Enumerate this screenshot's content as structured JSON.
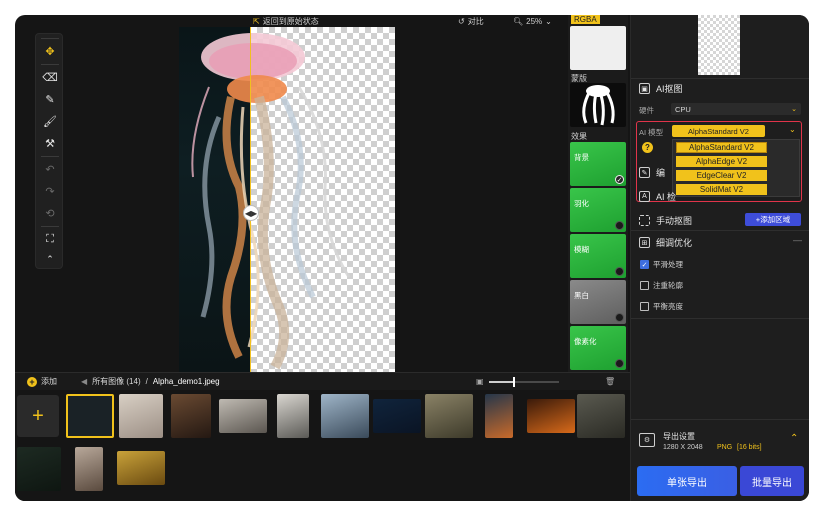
{
  "top": {
    "undo_label": "返回到原始状态",
    "compare_label": "对比",
    "zoom_label": "25%"
  },
  "tools": [
    "move-icon",
    "eraser-icon",
    "brush-icon",
    "restore-brush-icon",
    "paint-roller-icon",
    "undo-icon",
    "redo-icon",
    "reset-icon",
    "fit-screen-icon",
    "collapse-icon"
  ],
  "effects": {
    "rgba_label": "RGBA",
    "mask_label": "蒙版",
    "fx_label": "效果",
    "items": [
      {
        "label": "背景",
        "checked": true
      },
      {
        "label": "羽化",
        "checked": false
      },
      {
        "label": "模糊",
        "checked": false
      },
      {
        "label": "黑白",
        "checked": false
      },
      {
        "label": "像素化",
        "checked": false
      }
    ]
  },
  "panel": {
    "ai_matting_title": "AI抠图",
    "engine_label": "硬件",
    "engine_value": "CPU",
    "model_label": "AI 模型",
    "model_value": "AlphaStandard  V2",
    "model_options": [
      "AlphaStandard  V2",
      "AlphaEdge  V2",
      "EdgeClear  V2",
      "SolidMat  V2"
    ],
    "edit_partial": "编",
    "ai_partial": "AI 检",
    "manual_title": "手动抠图",
    "add_area_label": "添加区域",
    "refine_title": "细调优化",
    "checks": [
      {
        "label": "平滑处理",
        "checked": true
      },
      {
        "label": "注重轮廓",
        "checked": false
      },
      {
        "label": "平衡亮度",
        "checked": false
      }
    ],
    "export_title": "导出设置",
    "export_size": "1280 X 2048",
    "export_format": "PNG",
    "export_bits": "[16 bits]",
    "export_single": "单张导出",
    "export_batch": "批量导出"
  },
  "bottom": {
    "add_label": "添加",
    "all_images": "所有图像 (14)",
    "separator": "/",
    "current_file": "Alpha_demo1.jpeg"
  },
  "colors": {
    "accent": "#f1c21b",
    "button_blue": "#3a48d6",
    "highlight_red": "#e0344a"
  }
}
